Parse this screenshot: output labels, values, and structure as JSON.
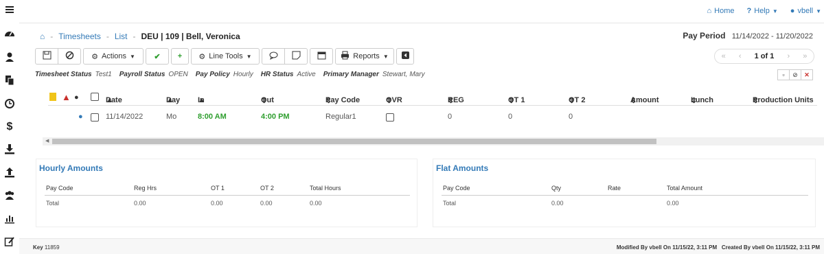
{
  "topnav": {
    "home": "Home",
    "help": "Help",
    "user": "vbell"
  },
  "breadcrumb": {
    "timesheets": "Timesheets",
    "list": "List",
    "current": "DEU | 109 | Bell, Veronica",
    "sep": "-"
  },
  "pay_period": {
    "label": "Pay Period",
    "value": "11/14/2022 - 11/20/2022"
  },
  "toolbar": {
    "actions": "Actions",
    "line_tools": "Line Tools",
    "reports": "Reports"
  },
  "pager": {
    "page": "1 of 1"
  },
  "status": [
    {
      "k": "Timesheet Status",
      "v": "Test1"
    },
    {
      "k": "Payroll Status",
      "v": "OPEN"
    },
    {
      "k": "Pay Policy",
      "v": "Hourly"
    },
    {
      "k": "HR Status",
      "v": "Active"
    },
    {
      "k": "Primary Manager",
      "v": "Stewart, Mary"
    }
  ],
  "table": {
    "headers": [
      "Date",
      "Day",
      "In",
      "Out",
      "Pay Code",
      "OVR",
      "REG",
      "OT 1",
      "OT 2",
      "Amount",
      "Lunch",
      "Production Units"
    ],
    "header_sorts": [
      "▲",
      "▲",
      "▲",
      "⇕",
      "⇕",
      "⇕",
      "⇕",
      "⇕",
      "⇕",
      "⇕",
      "⇕",
      "⇕"
    ],
    "row": {
      "date": "11/14/2022",
      "day": "Mo",
      "in": "8:00 AM",
      "out": "4:00 PM",
      "pay_code": "Regular1",
      "reg": "0",
      "ot1": "0",
      "ot2": "0"
    }
  },
  "hourly": {
    "title": "Hourly Amounts",
    "headers": [
      "Pay Code",
      "Reg Hrs",
      "OT 1",
      "OT 2",
      "Total Hours"
    ],
    "row": [
      "Total",
      "0.00",
      "0.00",
      "0.00",
      "0.00"
    ]
  },
  "flat": {
    "title": "Flat Amounts",
    "headers": [
      "Pay Code",
      "Qty",
      "Rate",
      "Total Amount"
    ],
    "row": [
      "Total",
      "0.00",
      "",
      "0.00"
    ]
  },
  "footer": {
    "key_label": "Key",
    "key": "11859",
    "modified": "Modified By vbell On 11/15/22, 3:11 PM",
    "created": "Created By vbell On 11/15/22, 3:11 PM"
  },
  "colors": {
    "link": "#337ab7",
    "green": "#2e9e2e",
    "warning": "#f0c419",
    "danger": "#c9302c"
  }
}
